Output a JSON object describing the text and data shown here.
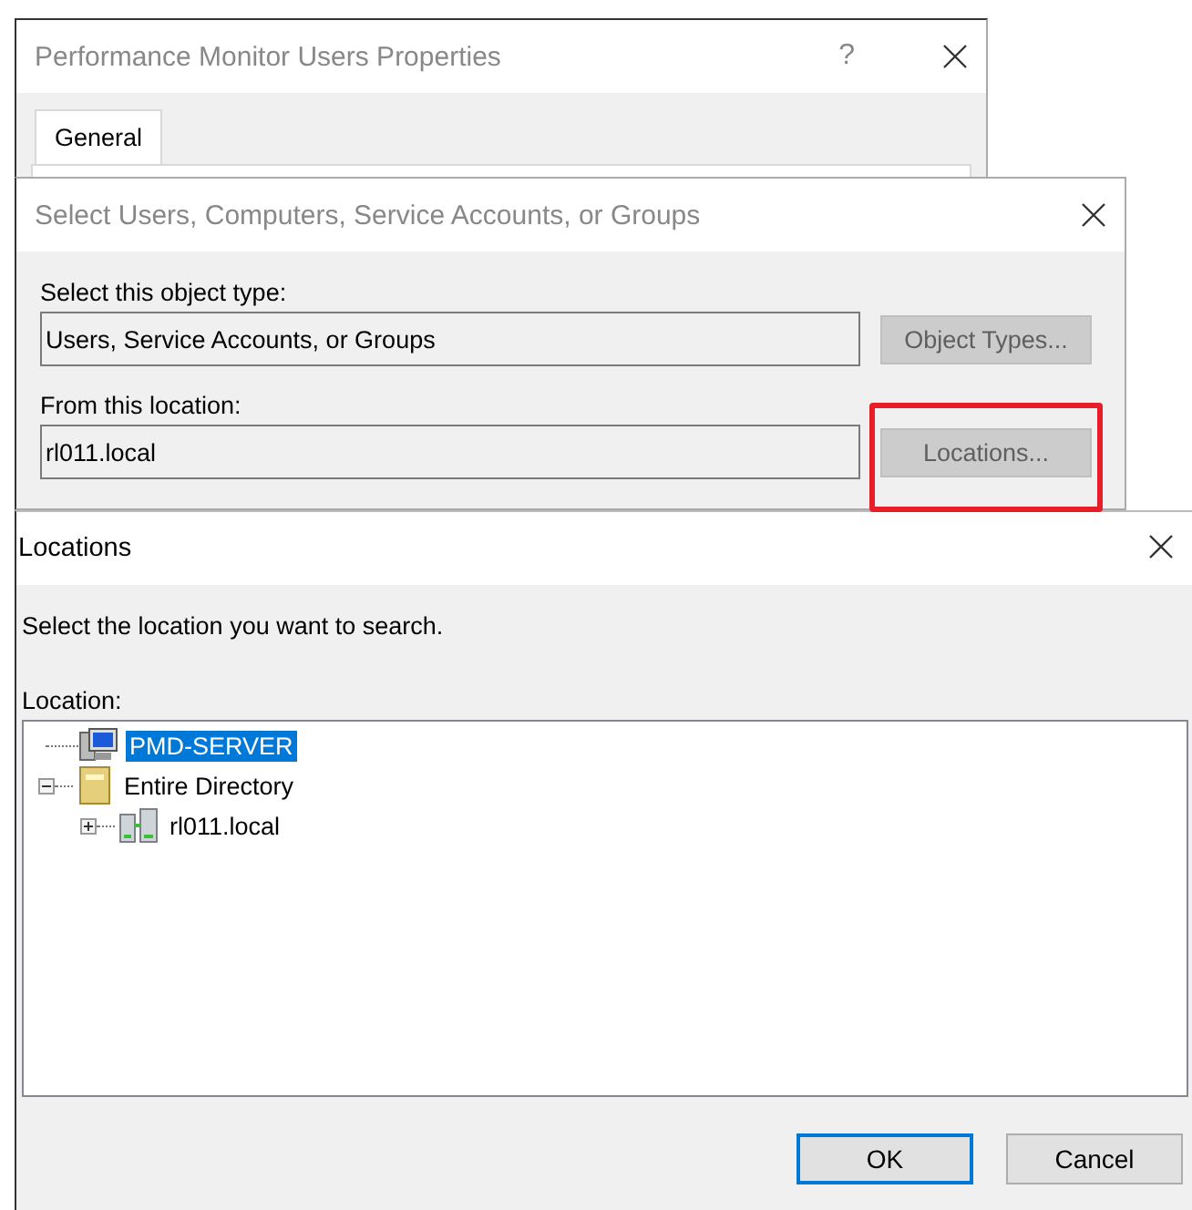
{
  "windows": [
    {
      "kind": "properties",
      "title": "Performance Monitor Users Properties",
      "help": "?",
      "tabs": [
        {
          "label": "General",
          "selected": true
        }
      ]
    },
    {
      "kind": "select",
      "title": "Select Users, Computers, Service Accounts, or Groups",
      "fields": [
        {
          "label": "Select this object type:",
          "value": "Users, Service Accounts, or Groups",
          "button": "Object Types...",
          "disabled": true,
          "highlighted": false
        },
        {
          "label": "From this location:",
          "value": "rl011.local",
          "button": "Locations...",
          "disabled": true,
          "highlighted": true
        }
      ]
    },
    {
      "kind": "locations",
      "title": "Locations",
      "prompt": "Select the location you want to search.",
      "tree_label": "Location:",
      "tree": [
        {
          "label": "PMD-SERVER",
          "kind": "computer",
          "selected": true
        },
        {
          "label": "Entire Directory",
          "kind": "directory",
          "selected": false,
          "expanded": true,
          "children": [
            {
              "label": "rl011.local",
              "kind": "domain",
              "selected": false,
              "expanded": false
            }
          ]
        }
      ],
      "buttons": [
        {
          "label": "OK",
          "default": true
        },
        {
          "label": "Cancel",
          "default": false
        }
      ]
    }
  ]
}
